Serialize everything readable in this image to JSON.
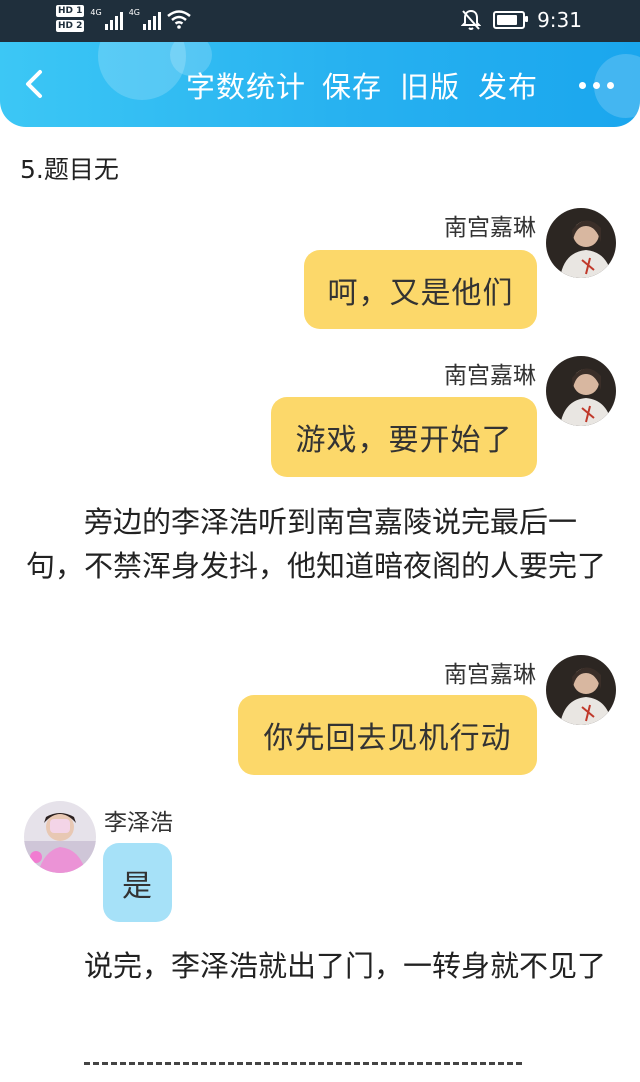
{
  "status_bar": {
    "hd1": "HD 1",
    "hd2": "HD 2",
    "net1": "4G",
    "net2": "4G",
    "time": "9:31"
  },
  "toolbar": {
    "word_count": "字数统计",
    "save": "保存",
    "old_version": "旧版",
    "publish": "发布"
  },
  "article": {
    "title": "5.题目无",
    "messages": [
      {
        "sender": "南宫嘉琳",
        "text": "呵，又是他们"
      },
      {
        "sender": "南宫嘉琳",
        "text": "游戏，要开始了"
      },
      {
        "sender": "南宫嘉琳",
        "text": "你先回去见机行动"
      },
      {
        "sender": "李泽浩",
        "text": "是"
      }
    ],
    "paragraph1": "旁边的李泽浩听到南宫嘉陵说完最后一句，不禁浑身发抖，他知道暗夜阁的人要完了",
    "paragraph2": "说完，李泽浩就出了门，一转身就不见了"
  },
  "colors": {
    "toolbar_gradient_start": "#3cc7f5",
    "toolbar_gradient_end": "#1aa6ee",
    "right_bubble": "#fcd86a",
    "left_bubble": "#a6e1f8",
    "status_bar": "#1f2f3c"
  }
}
